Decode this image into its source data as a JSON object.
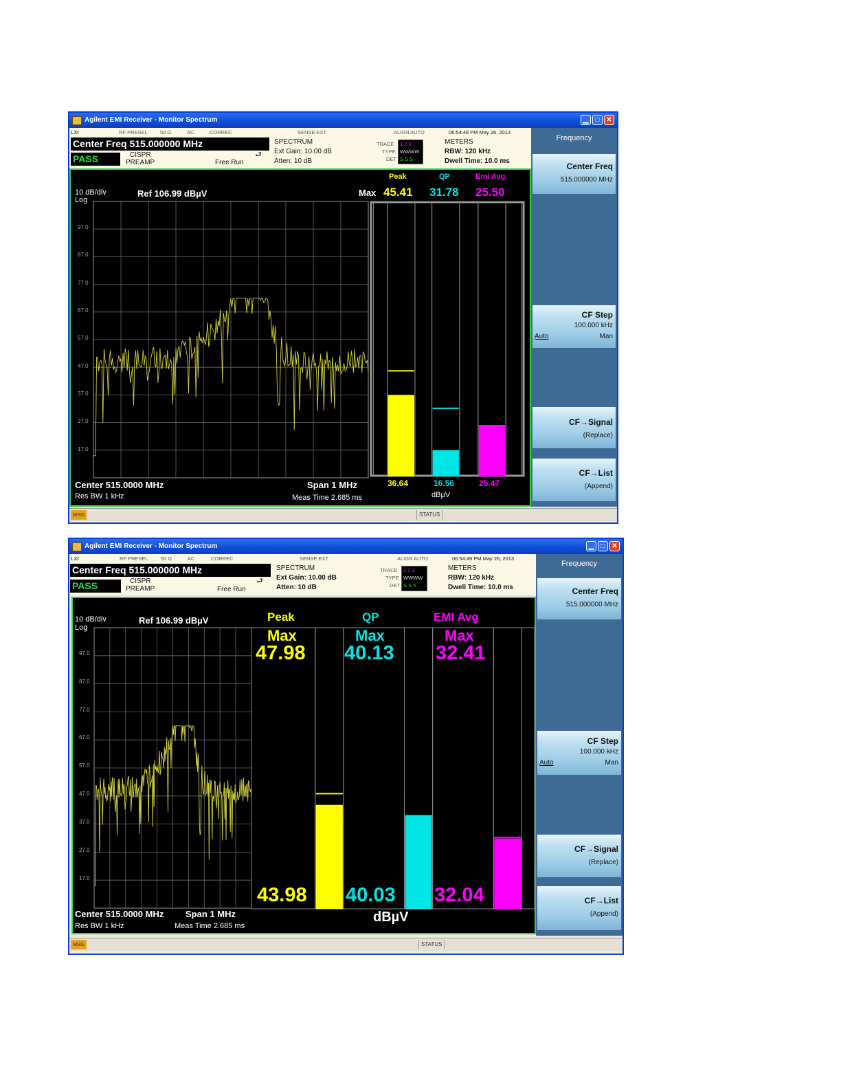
{
  "colors": {
    "peak": "#ffff00",
    "qp": "#00e5e5",
    "emi_avg": "#ff00ff",
    "pass": "#22e044",
    "frame": "#2fd43a",
    "trace": "#d6d33a"
  },
  "icons": [
    "app-icon",
    "minimize-icon",
    "maximize-icon",
    "close-icon",
    "trace-status-icon"
  ],
  "windows": [
    {
      "title": "Agilent EMI Receiver - Monitor Spectrum",
      "top_labels": {
        "lxi": "LXI",
        "rf_presel": "RF PRESEL",
        "ohm": "50 Ω",
        "ac": "AC",
        "correc": "CORREC",
        "sense": "SENSE:EXT",
        "align": "ALIGN AUTO",
        "datetime": "06:54:48 PM May 26, 2013"
      },
      "center_freq": "Center Freq 515.000000 MHz",
      "pass": "PASS",
      "cispr": "CISPR",
      "preamp": "PREAMP",
      "free_run": "Free Run",
      "spectrum": "SPECTRUM",
      "ext_gain": "Ext Gain: 10.00 dB",
      "atten": "Atten: 10 dB",
      "trace_labels": {
        "trace": "TRACE",
        "type": "TYPE",
        "det": "DET",
        "nums": "1 2 3",
        "types": "WWWW",
        "dets": "S S S"
      },
      "meters": "METERS",
      "rbw": "RBW: 120 kHz",
      "dwell": "Dwell Time: 10.0 ms",
      "scale": "10 dB/div",
      "log": "Log",
      "ref": "Ref 106.99 dBµV",
      "y_ticks": [
        "97.0",
        "87.0",
        "77.0",
        "67.0",
        "57.0",
        "47.0",
        "37.0",
        "27.0",
        "17.0"
      ],
      "center": "Center 515.0000 MHz",
      "span": "Span 1 MHz",
      "res_bw": "Res BW 1 kHz",
      "meas_time": "Meas Time 2.685 ms",
      "meters_panel": {
        "max_label": "Max",
        "headers": [
          "Peak",
          "QP",
          "Emi Avg"
        ],
        "max_values": [
          "45.41",
          "31.78",
          "25.50"
        ],
        "current_values": [
          "36.64",
          "16.56",
          "25.47"
        ],
        "unit": "dBµV"
      },
      "softkeys": {
        "header": "Frequency",
        "center_freq": "Center Freq",
        "center_freq_value": "515.000000 MHz",
        "cf_step": "CF Step",
        "cf_step_value": "100.000 kHz",
        "auto": "Auto",
        "man": "Man",
        "cf_signal": "CF→Signal",
        "replace": "(Replace)",
        "cf_list": "CF→List",
        "append": "(Append)"
      },
      "status": {
        "msg": "MSG",
        "status": "STATUS"
      }
    },
    {
      "title": "Agilent EMI Receiver - Monitor Spectrum",
      "top_labels": {
        "lxi": "LXI",
        "rf_presel": "RF PRESEL",
        "ohm": "50 Ω",
        "ac": "AC",
        "correc": "CORREC",
        "sense": "SENSE:EXT",
        "align": "ALIGN AUTO",
        "datetime": "06:54:49 PM May 26, 2013"
      },
      "center_freq": "Center Freq 515.000000 MHz",
      "pass": "PASS",
      "cispr": "CISPR",
      "preamp": "PREAMP",
      "free_run": "Free Run",
      "spectrum": "SPECTRUM",
      "ext_gain": "Ext Gain: 10.00 dB",
      "atten": "Atten: 10 dB",
      "trace_labels": {
        "trace": "TRACE",
        "type": "TYPE",
        "det": "DET",
        "nums": "1 2 3",
        "types": "WWWW",
        "dets": "S S S"
      },
      "meters": "METERS",
      "rbw": "RBW: 120 kHz",
      "dwell": "Dwell Time: 10.0 ms",
      "scale": "10 dB/div",
      "log": "Log",
      "ref": "Ref 106.99 dBµV",
      "y_ticks": [
        "97.0",
        "87.0",
        "77.0",
        "67.0",
        "57.0",
        "47.0",
        "37.0",
        "27.0",
        "17.0"
      ],
      "center": "Center 515.0000 MHz",
      "span": "Span 1 MHz",
      "res_bw": "Res BW 1 kHz",
      "meas_time": "Meas Time 2.685 ms",
      "meters_panel": {
        "max_label": "Max",
        "headers": [
          "Peak",
          "QP",
          "EMI Avg"
        ],
        "max_values": [
          "47.98",
          "40.13",
          "32.41"
        ],
        "current_values": [
          "43.98",
          "40.03",
          "32.04"
        ],
        "unit": "dBµV"
      },
      "softkeys": {
        "header": "Frequency",
        "center_freq": "Center Freq",
        "center_freq_value": "515.000000 MHz",
        "cf_step": "CF Step",
        "cf_step_value": "100.000 kHz",
        "auto": "Auto",
        "man": "Man",
        "cf_signal": "CF→Signal",
        "replace": "(Replace)",
        "cf_list": "CF→List",
        "append": "(Append)"
      },
      "status": {
        "msg": "MSG",
        "status": "STATUS"
      }
    }
  ]
}
